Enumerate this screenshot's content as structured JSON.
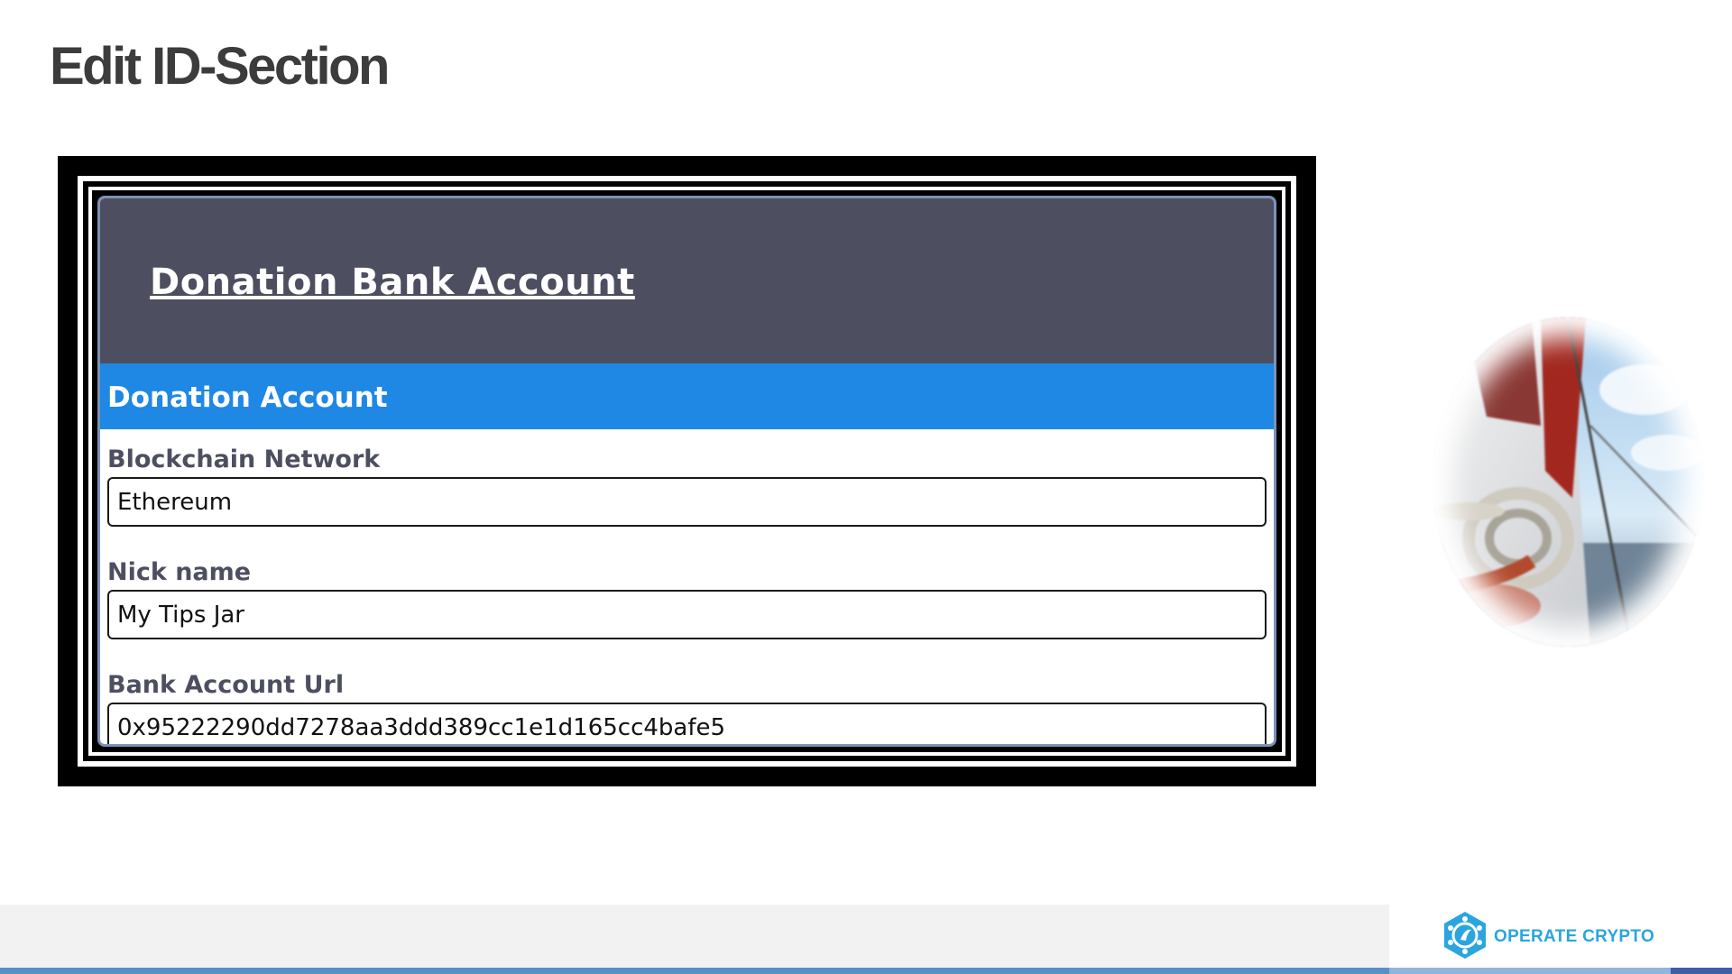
{
  "slide": {
    "title": "Edit ID-Section"
  },
  "form": {
    "header_title": "Donation Bank Account",
    "section_title": "Donation Account",
    "fields": [
      {
        "label": "Blockchain Network",
        "value": "Ethereum"
      },
      {
        "label": "Nick name",
        "value": "My Tips Jar"
      },
      {
        "label": "Bank Account Url",
        "value": "0x95222290dd7278aa3ddd389cc1e1d165cc4bafe5"
      }
    ]
  },
  "footer": {
    "brand_name": "OPERATE CRYPTO",
    "brand_icon": "hexagon-logo-icon"
  },
  "colors": {
    "header_bg": "#4d4f61",
    "section_bar": "#1f88e5",
    "brand": "#2aa5e0",
    "strip": [
      "#5b8ec9",
      "#8fb4de",
      "#3d5fa8"
    ]
  },
  "image": {
    "subject": "sailboat-rope-photo"
  }
}
